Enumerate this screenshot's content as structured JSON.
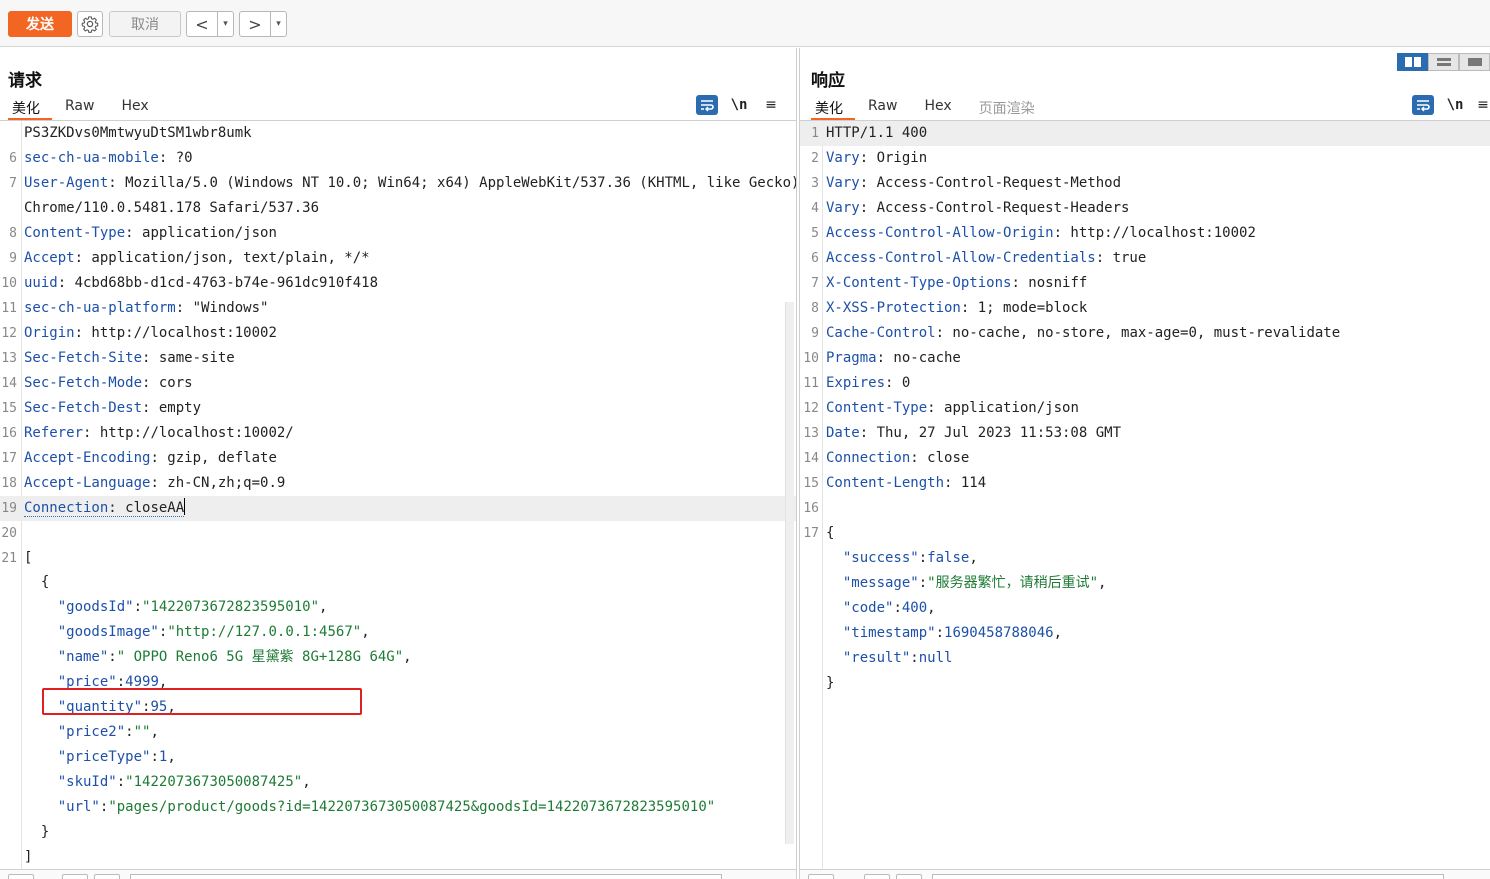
{
  "toolbar": {
    "send_label": "发送",
    "cancel_label": "取消",
    "back_glyph": "<",
    "forward_glyph": ">",
    "dropdown_glyph": "▾",
    "send_color": "#f26522"
  },
  "request": {
    "title": "请求",
    "tabs": [
      "美化",
      "Raw",
      "Hex"
    ],
    "active_tab": "美化"
  },
  "response": {
    "title": "响应",
    "tabs": [
      "美化",
      "Raw",
      "Hex",
      "页面渲染"
    ],
    "active_tab": "美化"
  },
  "icons": {
    "wrap": "word-wrap-icon",
    "newline": "\\n",
    "menu": "≡"
  },
  "request_lines": [
    {
      "n": "",
      "k": "",
      "v": "PS3ZKDvs0MmtwyuDtSM1wbr8umk"
    },
    {
      "n": "6",
      "k": "sec-ch-ua-mobile",
      "v": ": ?0"
    },
    {
      "n": "7",
      "k": "User-Agent",
      "v": ": Mozilla/5.0 (Windows NT 10.0; Win64; x64) AppleWebKit/537.36 (KHTML, like Gecko)"
    },
    {
      "n": "",
      "k": "",
      "v": "Chrome/110.0.5481.178 Safari/537.36"
    },
    {
      "n": "8",
      "k": "Content-Type",
      "v": ": application/json"
    },
    {
      "n": "9",
      "k": "Accept",
      "v": ": application/json, text/plain, */*"
    },
    {
      "n": "10",
      "k": "uuid",
      "v": ": 4cbd68bb-d1cd-4763-b74e-961dc910f418"
    },
    {
      "n": "11",
      "k": "sec-ch-ua-platform",
      "v": ": \"Windows\""
    },
    {
      "n": "12",
      "k": "Origin",
      "v": ": http://localhost:10002"
    },
    {
      "n": "13",
      "k": "Sec-Fetch-Site",
      "v": ": same-site"
    },
    {
      "n": "14",
      "k": "Sec-Fetch-Mode",
      "v": ": cors"
    },
    {
      "n": "15",
      "k": "Sec-Fetch-Dest",
      "v": ": empty"
    },
    {
      "n": "16",
      "k": "Referer",
      "v": ": http://localhost:10002/"
    },
    {
      "n": "17",
      "k": "Accept-Encoding",
      "v": ": gzip, deflate"
    },
    {
      "n": "18",
      "k": "Accept-Language",
      "v": ": zh-CN,zh;q=0.9"
    },
    {
      "n": "19",
      "k": "Connection",
      "v": ": closeAA"
    },
    {
      "n": "20",
      "k": "",
      "v": ""
    },
    {
      "n": "21",
      "k": "",
      "v": "["
    }
  ],
  "request_body": [
    {
      "indent": "  ",
      "text": "{"
    },
    {
      "indent": "    ",
      "key": "\"goodsId\"",
      "sep": ":",
      "str": "\"1422073672823595010\"",
      "end": ","
    },
    {
      "indent": "    ",
      "key": "\"goodsImage\"",
      "sep": ":",
      "str": "\"http://127.0.0.1:4567\"",
      "end": ","
    },
    {
      "indent": "    ",
      "key": "\"name\"",
      "sep": ":",
      "str": "\" OPPO Reno6 5G 星黛紫 8G+128G 64G\"",
      "end": ","
    },
    {
      "indent": "    ",
      "key": "\"price\"",
      "sep": ":",
      "num": "4999",
      "end": ","
    },
    {
      "indent": "    ",
      "key": "\"quantity\"",
      "sep": ":",
      "num": "95",
      "end": ","
    },
    {
      "indent": "    ",
      "key": "\"price2\"",
      "sep": ":",
      "str": "\"\"",
      "end": ","
    },
    {
      "indent": "    ",
      "key": "\"priceType\"",
      "sep": ":",
      "num": "1",
      "end": ","
    },
    {
      "indent": "    ",
      "key": "\"skuId\"",
      "sep": ":",
      "str": "\"1422073673050087425\"",
      "end": ","
    },
    {
      "indent": "    ",
      "key": "\"url\"",
      "sep": ":",
      "str": "\"pages/product/goods?id=1422073673050087425&goodsId=1422073672823595010\"",
      "end": ""
    },
    {
      "indent": "  ",
      "text": "}"
    },
    {
      "indent": "",
      "text": "]"
    }
  ],
  "response_lines": [
    {
      "n": "1",
      "k": "",
      "v": "HTTP/1.1 400"
    },
    {
      "n": "2",
      "k": "Vary",
      "v": ": Origin"
    },
    {
      "n": "3",
      "k": "Vary",
      "v": ": Access-Control-Request-Method"
    },
    {
      "n": "4",
      "k": "Vary",
      "v": ": Access-Control-Request-Headers"
    },
    {
      "n": "5",
      "k": "Access-Control-Allow-Origin",
      "v": ": http://localhost:10002"
    },
    {
      "n": "6",
      "k": "Access-Control-Allow-Credentials",
      "v": ": true"
    },
    {
      "n": "7",
      "k": "X-Content-Type-Options",
      "v": ": nosniff"
    },
    {
      "n": "8",
      "k": "X-XSS-Protection",
      "v": ": 1; mode=block"
    },
    {
      "n": "9",
      "k": "Cache-Control",
      "v": ": no-cache, no-store, max-age=0, must-revalidate"
    },
    {
      "n": "10",
      "k": "Pragma",
      "v": ": no-cache"
    },
    {
      "n": "11",
      "k": "Expires",
      "v": ": 0"
    },
    {
      "n": "12",
      "k": "Content-Type",
      "v": ": application/json"
    },
    {
      "n": "13",
      "k": "Date",
      "v": ": Thu, 27 Jul 2023 11:53:08 GMT"
    },
    {
      "n": "14",
      "k": "Connection",
      "v": ": close"
    },
    {
      "n": "15",
      "k": "Content-Length",
      "v": ": 114"
    },
    {
      "n": "16",
      "k": "",
      "v": ""
    },
    {
      "n": "17",
      "k": "",
      "v": "{"
    }
  ],
  "response_body": [
    {
      "indent": "  ",
      "key": "\"success\"",
      "sep": ":",
      "num": "false",
      "end": ","
    },
    {
      "indent": "  ",
      "key": "\"message\"",
      "sep": ":",
      "str": "\"服务器繁忙，请稍后重试\"",
      "end": ","
    },
    {
      "indent": "  ",
      "key": "\"code\"",
      "sep": ":",
      "num": "400",
      "end": ","
    },
    {
      "indent": "  ",
      "key": "\"timestamp\"",
      "sep": ":",
      "num": "1690458788046",
      "end": ","
    },
    {
      "indent": "  ",
      "key": "\"result\"",
      "sep": ":",
      "num": "null",
      "end": ""
    },
    {
      "indent": "",
      "text": "}"
    }
  ],
  "colors": {
    "accent": "#f26522",
    "header_key": "#1d50a8",
    "json_string": "#1e7b35",
    "highlight_box": "#e02020",
    "toggle_active": "#2b6cb0"
  }
}
